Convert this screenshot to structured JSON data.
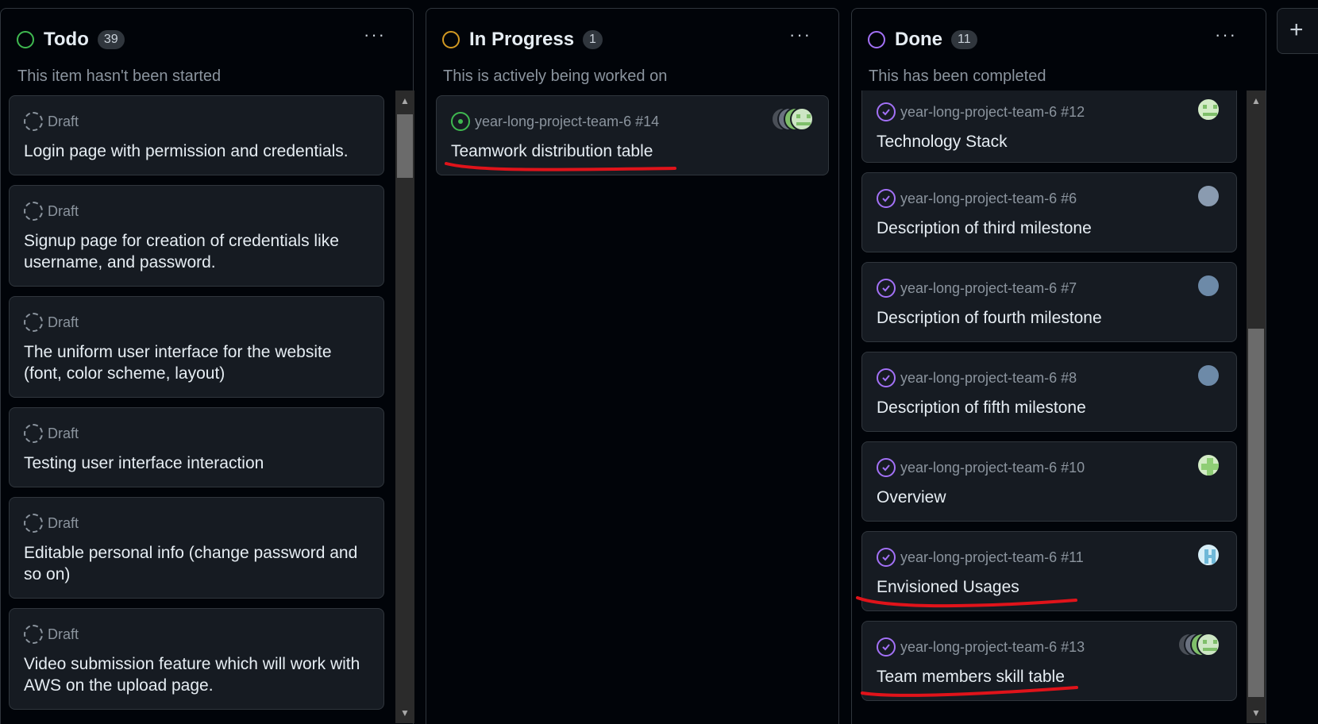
{
  "columns": {
    "todo": {
      "title": "Todo",
      "count": "39",
      "description": "This item hasn't been started",
      "status_color": "#3fb950",
      "menu": "···",
      "cards": [
        {
          "meta": "Draft",
          "title": "Login page with permission and credentials."
        },
        {
          "meta": "Draft",
          "title": "Signup page for creation of credentials like username, and password."
        },
        {
          "meta": "Draft",
          "title": "The uniform user interface for the website (font, color scheme, layout)"
        },
        {
          "meta": "Draft",
          "title": "Testing user interface interaction"
        },
        {
          "meta": "Draft",
          "title": "Editable personal info (change password and so on)"
        },
        {
          "meta": "Draft",
          "title": "Video submission feature which will work with AWS on the upload page."
        }
      ]
    },
    "in_progress": {
      "title": "In Progress",
      "count": "1",
      "description": "This is actively being worked on",
      "status_color": "#d29922",
      "menu": "···",
      "cards": [
        {
          "meta": "year-long-project-team-6 #14",
          "title": "Teamwork distribution table"
        }
      ]
    },
    "done": {
      "title": "Done",
      "count": "11",
      "description": "This has been completed",
      "status_color": "#a371f7",
      "menu": "···",
      "cards": [
        {
          "meta": "year-long-project-team-6 #12",
          "title": "Technology Stack"
        },
        {
          "meta": "year-long-project-team-6 #6",
          "title": "Description of third milestone"
        },
        {
          "meta": "year-long-project-team-6 #7",
          "title": "Description of fourth milestone"
        },
        {
          "meta": "year-long-project-team-6 #8",
          "title": "Description of fifth milestone"
        },
        {
          "meta": "year-long-project-team-6 #10",
          "title": "Overview"
        },
        {
          "meta": "year-long-project-team-6 #11",
          "title": "Envisioned Usages"
        },
        {
          "meta": "year-long-project-team-6 #13",
          "title": "Team members skill table"
        }
      ]
    }
  },
  "add_column": "+",
  "colors": {
    "background": "#010409",
    "card": "#161b22",
    "border": "#30363d",
    "annotation": "#e0131a"
  }
}
